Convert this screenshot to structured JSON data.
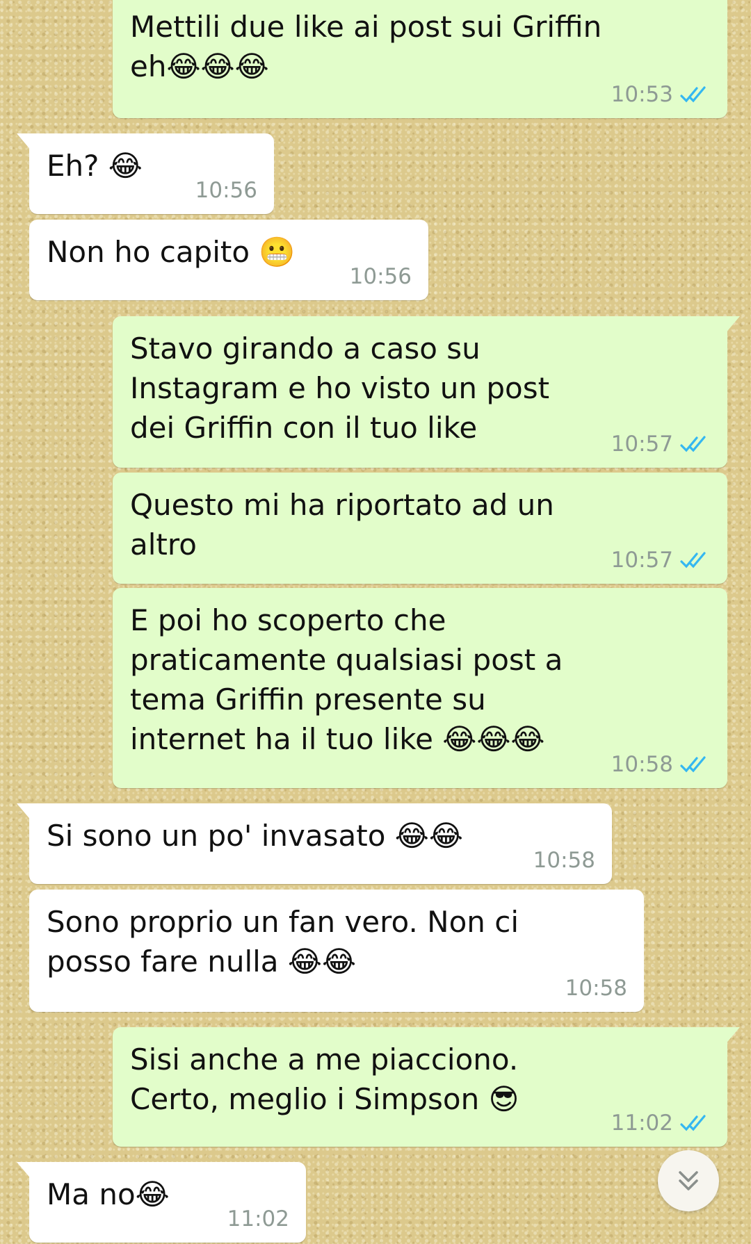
{
  "messages": [
    {
      "id": "m1",
      "dir": "out",
      "text": "Mettili due like ai post sui Griffin eh😂😂😂",
      "time": "10:53",
      "read": true
    },
    {
      "id": "m2",
      "dir": "in",
      "text": "Eh? 😂",
      "time": "10:56"
    },
    {
      "id": "m3",
      "dir": "in",
      "text": "Non ho capito 😬",
      "time": "10:56"
    },
    {
      "id": "m4",
      "dir": "out",
      "text": "Stavo girando a caso su Instagram e ho visto un post dei Griffin con il tuo like",
      "time": "10:57",
      "read": true
    },
    {
      "id": "m5",
      "dir": "out",
      "text": "Questo mi ha riportato ad un altro",
      "time": "10:57",
      "read": true
    },
    {
      "id": "m6",
      "dir": "out",
      "text": "E poi ho scoperto che praticamente qualsiasi post a tema Griffin presente su internet ha il tuo like 😂😂😂",
      "time": "10:58",
      "read": true
    },
    {
      "id": "m7",
      "dir": "in",
      "text": "Si sono un po' invasato 😂😂",
      "time": "10:58"
    },
    {
      "id": "m8",
      "dir": "in",
      "text": "Sono proprio un fan vero. Non ci posso fare nulla 😂😂",
      "time": "10:58"
    },
    {
      "id": "m9",
      "dir": "out",
      "text": "Sisi anche a me piacciono. Certo, meglio i Simpson 😎",
      "time": "11:02",
      "read": true
    },
    {
      "id": "m10",
      "dir": "in",
      "text": "Ma no😂",
      "time": "11:02"
    }
  ],
  "icons": {
    "read_receipt": "double-check-icon",
    "scroll": "chevron-double-down-icon"
  },
  "colors": {
    "incoming_bubble": "#ffffff",
    "outgoing_bubble": "#e2fdca",
    "read_tick": "#34b7f1",
    "timestamp": "#8e9a94"
  }
}
